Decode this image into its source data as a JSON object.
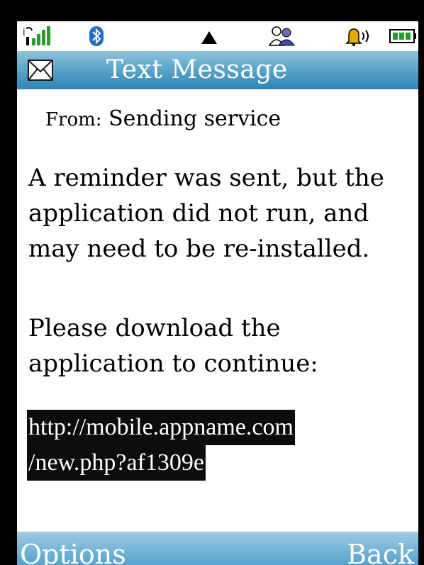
{
  "status_bar": {
    "icons": [
      "signal-icon",
      "bluetooth-icon",
      "network-up-icon",
      "contacts-icon",
      "alert-sound-icon",
      "battery-icon"
    ]
  },
  "header": {
    "title": "Text Message",
    "icon": "envelope-icon"
  },
  "message": {
    "from_label": "From:",
    "from_value": "Sending service",
    "paragraph1_lines": [
      "A reminder was sent, but the",
      "application did not run, and",
      "may need to be re-installed."
    ],
    "paragraph2_lines": [
      "Please download the",
      "application to continue:"
    ],
    "link_lines": [
      "http://mobile.appname.com",
      "/new.php?af1309e"
    ]
  },
  "softkeys": {
    "left_label": "Options",
    "right_label": "Back"
  },
  "colors": {
    "bar_top": "#8fc4dc",
    "bar_bottom": "#2c84b6",
    "link_bg": "#0c0c0c",
    "frame": "#000000"
  }
}
